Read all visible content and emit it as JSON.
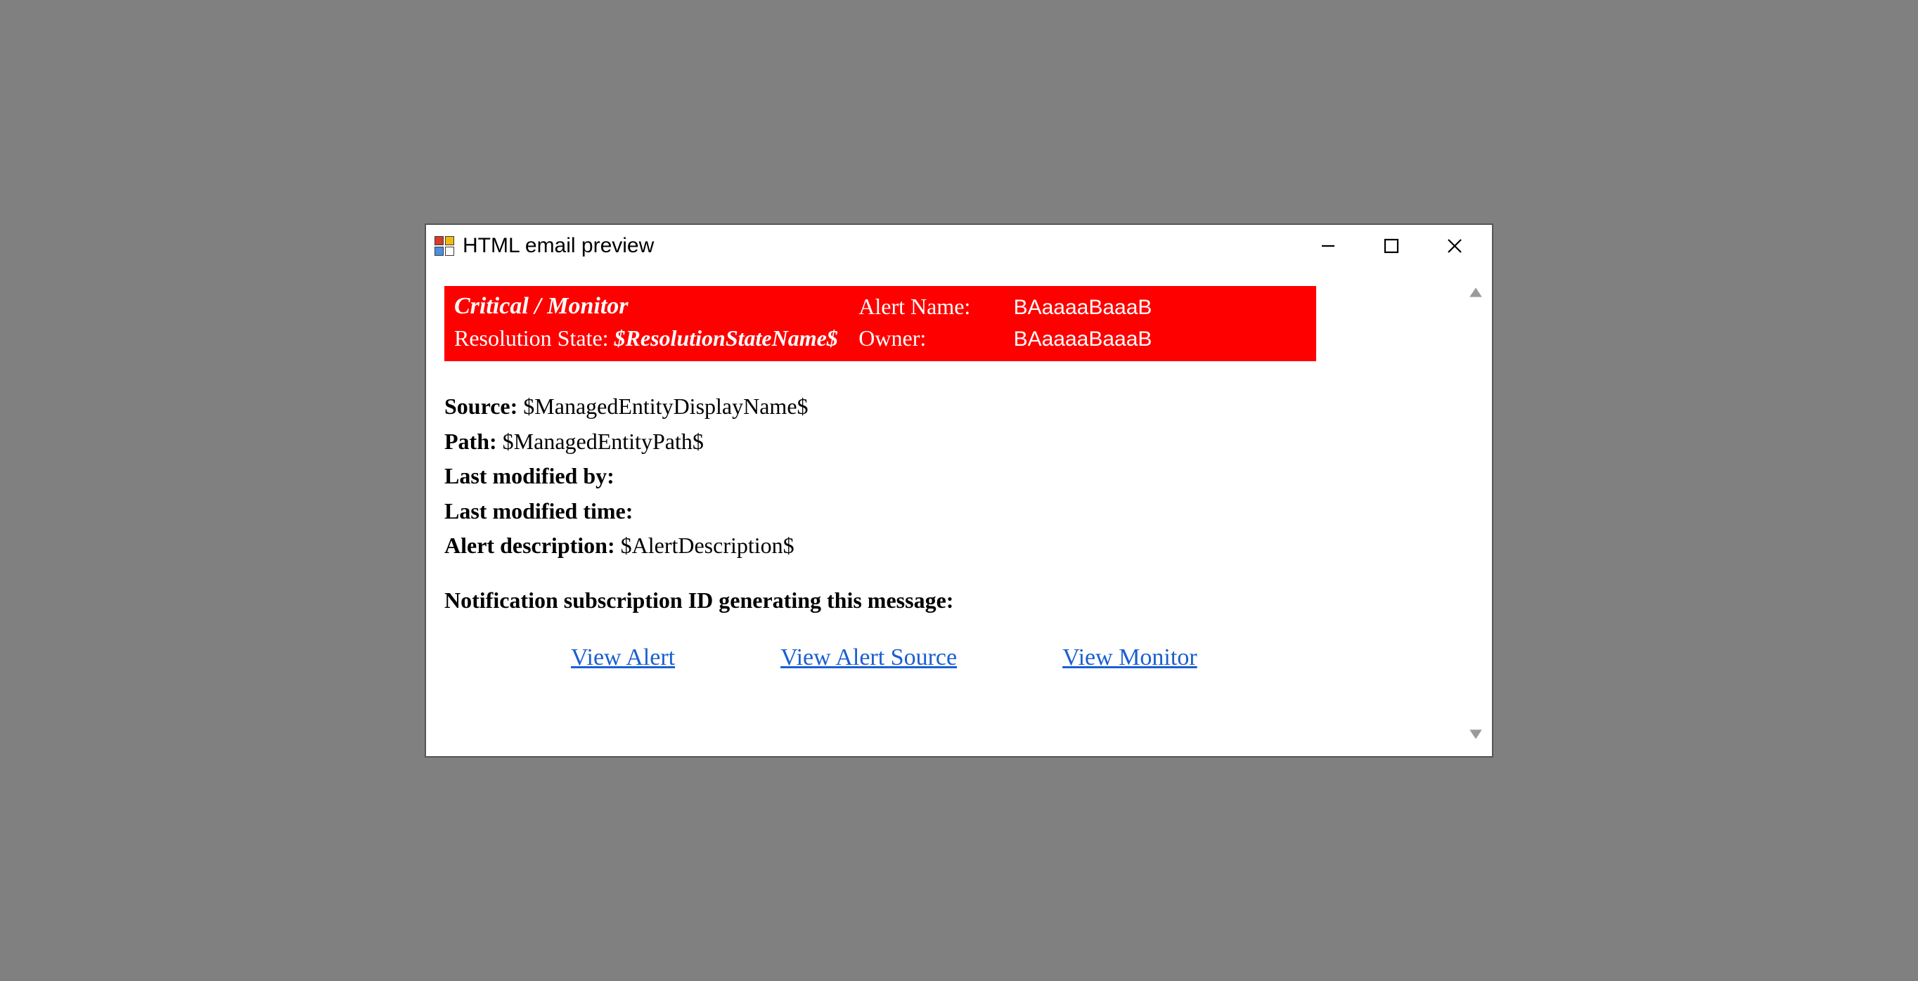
{
  "window": {
    "title": "HTML email preview"
  },
  "header": {
    "severity_source": "Critical / Monitor",
    "alert_name_label": "Alert Name:",
    "alert_name_value": "BAaaaaBaaaB",
    "resolution_state_label": "Resolution State:",
    "resolution_state_value": "$ResolutionStateName$",
    "owner_label": "Owner:",
    "owner_value": "BAaaaaBaaaB"
  },
  "fields": {
    "source_label": "Source:",
    "source_value": "$ManagedEntityDisplayName$",
    "path_label": "Path:",
    "path_value": "$ManagedEntityPath$",
    "last_modified_by_label": "Last modified by:",
    "last_modified_by_value": "",
    "last_modified_time_label": "Last modified time:",
    "last_modified_time_value": "",
    "alert_description_label": "Alert description:",
    "alert_description_value": "$AlertDescription$"
  },
  "subscription": {
    "label": "Notification subscription ID generating this message:",
    "value": ""
  },
  "links": {
    "view_alert": "View Alert",
    "view_alert_source": "View Alert Source",
    "view_monitor": "View Monitor"
  }
}
